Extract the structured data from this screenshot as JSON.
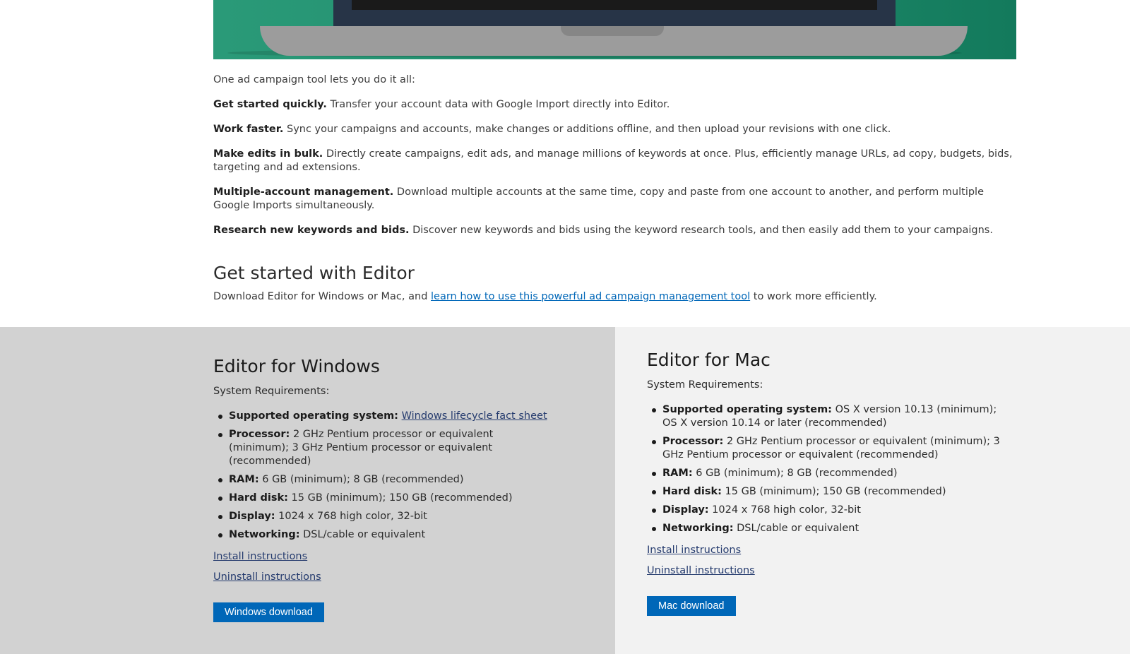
{
  "intro": "One ad campaign tool lets you do it all:",
  "features": [
    {
      "title": "Get started quickly.",
      "text": " Transfer your account data with Google Import directly into Editor."
    },
    {
      "title": "Work faster.",
      "text": " Sync your campaigns and accounts, make changes or additions offline, and then upload your revisions with one click."
    },
    {
      "title": "Make edits in bulk.",
      "text": " Directly create campaigns, edit ads, and manage millions of keywords at once. Plus, efficiently manage URLs, ad copy, budgets, bids, targeting and ad extensions."
    },
    {
      "title": "Multiple-account management.",
      "text": " Download multiple accounts at the same time, copy and paste from one account to another, and perform multiple Google Imports simultaneously."
    },
    {
      "title": "Research new keywords and bids.",
      "text": " Discover new keywords and bids using the keyword research tools, and then easily add them to your campaigns."
    }
  ],
  "get_started": {
    "title": "Get started with Editor",
    "desc_before": "Download Editor for Windows or Mac, and ",
    "link": "learn how to use this powerful ad campaign management tool",
    "desc_after": " to work more efficiently."
  },
  "windows": {
    "title": "Editor for Windows",
    "sysreq": "System Requirements:",
    "os_label": "Supported operating system:",
    "os_link": "Windows lifecycle fact sheet",
    "processor_label": "Processor:",
    "processor": " 2 GHz Pentium processor or equivalent (minimum); 3 GHz Pentium processor or equivalent (recommended)",
    "ram_label": "RAM:",
    "ram": " 6 GB (minimum); 8 GB (recommended)",
    "disk_label": "Hard disk:",
    "disk": " 15 GB (minimum); 150 GB (recommended)",
    "display_label": "Display:",
    "display": " 1024 x 768 high color, 32-bit",
    "net_label": "Networking:",
    "net": " DSL/cable or equivalent",
    "install": "Install instructions",
    "uninstall": "Uninstall instructions",
    "download": "Windows download"
  },
  "mac": {
    "title": "Editor for Mac",
    "sysreq": "System Requirements:",
    "os_label": "Supported operating system:",
    "os": " OS X version 10.13 (minimum); OS X version 10.14 or later (recommended)",
    "processor_label": "Processor:",
    "processor": " 2 GHz Pentium processor or equivalent (minimum); 3 GHz Pentium processor or equivalent (recommended)",
    "ram_label": "RAM:",
    "ram": " 6 GB (minimum); 8 GB (recommended)",
    "disk_label": "Hard disk:",
    "disk": " 15 GB (minimum); 150 GB (recommended)",
    "display_label": "Display:",
    "display": " 1024 x 768 high color, 32-bit",
    "net_label": "Networking:",
    "net": " DSL/cable or equivalent",
    "install": "Install instructions",
    "uninstall": "Uninstall instructions",
    "download": "Mac download"
  },
  "colors": {
    "hero_green": "#1f8a6b",
    "button_blue": "#0067b8",
    "link_blue": "#0067b8",
    "windows_panel": "#d2d2d2",
    "mac_panel": "#f2f2f2"
  }
}
